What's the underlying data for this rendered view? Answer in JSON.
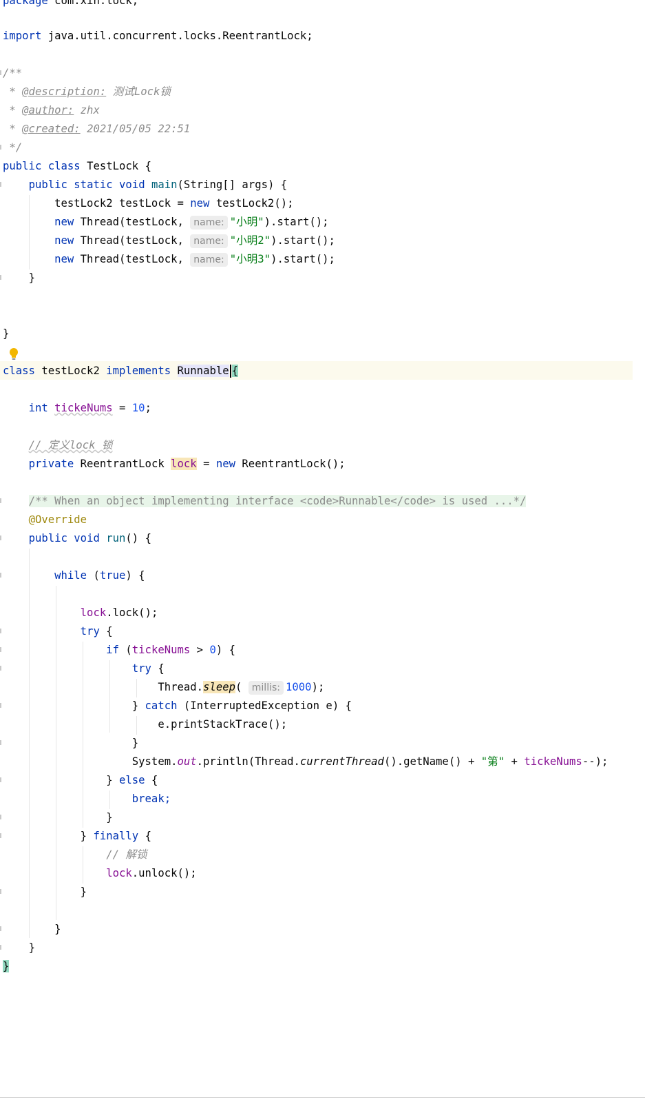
{
  "colors": {
    "keyword": "#0033b3",
    "string": "#067d17",
    "number": "#1750eb",
    "field": "#871094",
    "comment": "#8c8c8c",
    "annotation": "#9e880d",
    "method_decl": "#00627a",
    "caret_line_bg": "#fcfaed",
    "doc_bg": "#e8f5e9",
    "match_bg": "#e6e6fa",
    "brace_match_bg": "#93d9c0",
    "usage_bg": "#f8e6b8"
  },
  "icons": {
    "intention": "lightbulb-icon"
  },
  "code": {
    "pkg_kw": "package",
    "pkg_name": "com.xin.lock;",
    "import_kw": "import",
    "import_name": "java.util.concurrent.locks.ReentrantLock;",
    "doc_open": "/**",
    "doc_star": "*",
    "doc_desc_tag": "@description:",
    "doc_desc_text": "测试Lock锁",
    "doc_author_tag": "@author:",
    "doc_author_text": "zhx",
    "doc_created_tag": "@created:",
    "doc_created_text": "2021/05/05 22:51",
    "doc_close": "*/",
    "kw_public": "public",
    "kw_class": "class",
    "kw_static": "static",
    "kw_void": "void",
    "kw_new": "new",
    "kw_implements": "implements",
    "kw_int": "int",
    "kw_private": "private",
    "kw_while": "while",
    "kw_true": "true",
    "kw_try": "try",
    "kw_if": "if",
    "kw_catch": "catch",
    "kw_else": "else",
    "kw_break": "break;",
    "kw_finally": "finally",
    "class_testlock": "TestLock",
    "open_brace": "{",
    "close_brace": "}",
    "main_name": "main",
    "main_params": "(String[] args) {",
    "inst_type": "testLock2 testLock =",
    "inst_ctor": "testLock2();",
    "thread_open": "Thread(testLock,",
    "hint_name": "name:",
    "thread_str1": "\"小明\"",
    "thread_str2": "\"小明2\"",
    "thread_str3": "\"小明3\"",
    "thread_close": ").start();",
    "class_testlock2": "testLock2",
    "runnable": "Runnable",
    "field_tickets": "tickeNums",
    "assign": "=",
    "num_10": "10",
    "semicolon": ";",
    "comment_lock": "// 定义lock 锁",
    "type_reentrant": "ReentrantLock",
    "field_lock": "lock",
    "ctor_reentrant": "ReentrantLock();",
    "doc_collapsed": "/** When an object implementing interface <code>Runnable</code> is used ...*/",
    "override": "@Override",
    "run_name": "run",
    "run_params": "() {",
    "cond_open": "(",
    "cond_close": ") {",
    "call_lock": ".lock();",
    "gt": ">",
    "num_0": "0",
    "thread_cls": "Thread.",
    "sleep_name": "sleep",
    "paren_open": "(",
    "hint_millis": "millis:",
    "num_1000": "1000",
    "paren_close_semi": ");",
    "catch_rest": "(InterruptedException e) {",
    "print_stack": "e.printStackTrace();",
    "sys": "System.",
    "out_field": "out",
    "println_open": ".println(Thread.",
    "current_thread": "currentThread",
    "getname": "().getName() +",
    "str_di": "\"第\"",
    "plus": "+",
    "decrement": "--);",
    "comment_unlock": "// 解锁",
    "call_unlock": ".unlock();"
  }
}
